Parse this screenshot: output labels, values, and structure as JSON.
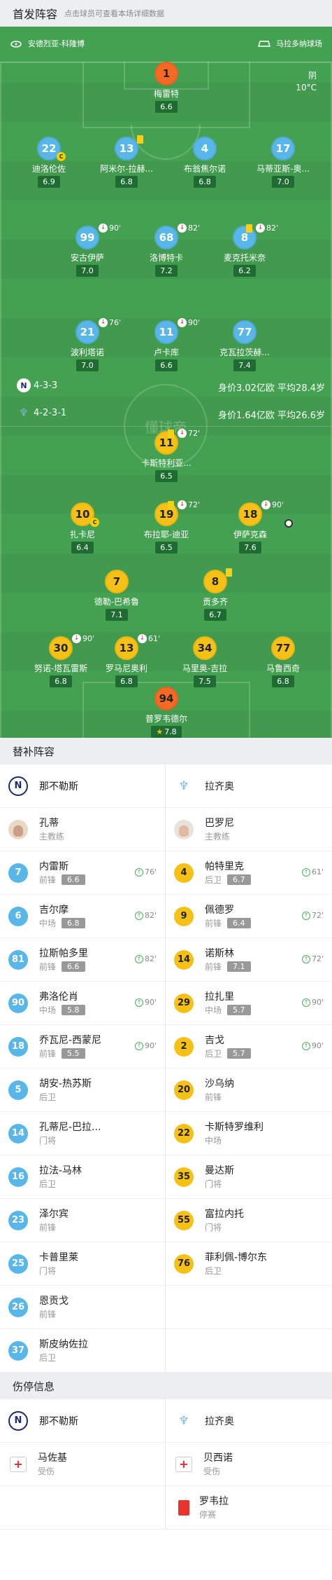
{
  "header": {
    "title": "首发阵容",
    "subtitle": "点击球员可查看本场详细数据"
  },
  "venue": {
    "stadium": "安德烈亚-科隆博",
    "stadium2": "马拉多纳球场"
  },
  "weather": {
    "condition": "阴",
    "temp": "10°C"
  },
  "watermark": "懂球帝",
  "napoli_form": {
    "formation": "4-3-3",
    "value": "身价3.02亿欧  平均28.4岁"
  },
  "lazio_form": {
    "formation": "4-2-3-1",
    "value": "身价1.64亿欧  平均26.6岁"
  },
  "pitch_players": [
    {
      "num": "1",
      "name": "梅雷特",
      "rating": "6.6",
      "color": "orange"
    },
    {
      "num": "22",
      "name": "迪洛伦佐",
      "rating": "6.9",
      "color": "blue",
      "captain": "C"
    },
    {
      "num": "13",
      "name": "阿米尔-拉赫...",
      "rating": "6.8",
      "color": "blue",
      "yellow": true
    },
    {
      "num": "4",
      "name": "布翁焦尔诺",
      "rating": "6.8",
      "color": "blue"
    },
    {
      "num": "17",
      "name": "马蒂亚斯-奥...",
      "rating": "7.0",
      "color": "blue"
    },
    {
      "num": "99",
      "name": "安古伊萨",
      "rating": "7.0",
      "color": "blue",
      "sub": "90'"
    },
    {
      "num": "68",
      "name": "洛博特卡",
      "rating": "7.2",
      "color": "blue",
      "sub": "82'"
    },
    {
      "num": "8",
      "name": "麦克托米奈",
      "rating": "6.2",
      "color": "blue",
      "sub": "82'",
      "yellow": true
    },
    {
      "num": "21",
      "name": "波利塔诺",
      "rating": "7.0",
      "color": "blue",
      "sub": "76'"
    },
    {
      "num": "11",
      "name": "卢卡库",
      "rating": "6.6",
      "color": "blue",
      "sub": "90'"
    },
    {
      "num": "77",
      "name": "克瓦拉茨赫...",
      "rating": "7.4",
      "color": "blue"
    },
    {
      "num": "11",
      "name": "卡斯特利亚...",
      "rating": "6.5",
      "color": "yellow",
      "sub": "72'",
      "yellow": true
    },
    {
      "num": "10",
      "name": "扎卡尼",
      "rating": "6.4",
      "color": "yellow",
      "captain": "C"
    },
    {
      "num": "19",
      "name": "布拉耶-迪亚",
      "rating": "6.5",
      "color": "yellow",
      "sub": "72'",
      "yellow": true
    },
    {
      "num": "18",
      "name": "伊萨克森",
      "rating": "7.6",
      "color": "yellow",
      "sub": "90'",
      "goal": true
    },
    {
      "num": "7",
      "name": "德勒-巴希鲁",
      "rating": "7.1",
      "color": "yellow"
    },
    {
      "num": "8",
      "name": "贡多齐",
      "rating": "6.7",
      "color": "yellow",
      "yellow": true
    },
    {
      "num": "30",
      "name": "努诺-塔瓦雷斯",
      "rating": "6.8",
      "color": "yellow",
      "sub": "90'"
    },
    {
      "num": "13",
      "name": "罗马尼奥利",
      "rating": "6.8",
      "color": "yellow",
      "sub": "61'"
    },
    {
      "num": "34",
      "name": "马里奥-吉拉",
      "rating": "7.5",
      "color": "yellow"
    },
    {
      "num": "77",
      "name": "马鲁西奇",
      "rating": "6.8",
      "color": "yellow"
    },
    {
      "num": "94",
      "name": "普罗韦德尔",
      "rating": "7.8",
      "color": "orange",
      "star": "★"
    }
  ],
  "bench_title": "替补阵容",
  "teams": {
    "napoli": "那不勒斯",
    "lazio": "拉齐奥"
  },
  "coaches": {
    "napoli": {
      "name": "孔蒂",
      "role": "主教练"
    },
    "lazio": {
      "name": "巴罗尼",
      "role": "主教练"
    }
  },
  "bench_napoli": [
    {
      "num": "7",
      "name": "内雷斯",
      "pos": "前锋",
      "rating": "6.6",
      "on": "76'"
    },
    {
      "num": "6",
      "name": "吉尔摩",
      "pos": "中场",
      "rating": "6.8",
      "on": "82'"
    },
    {
      "num": "81",
      "name": "拉斯帕多里",
      "pos": "前锋",
      "rating": "6.6",
      "on": "82'"
    },
    {
      "num": "90",
      "name": "弗洛伦肖",
      "pos": "中场",
      "rating": "5.8",
      "on": "90'"
    },
    {
      "num": "18",
      "name": "乔瓦尼-西蒙尼",
      "pos": "前锋",
      "rating": "5.5",
      "on": "90'"
    },
    {
      "num": "5",
      "name": "胡安-热苏斯",
      "pos": "后卫"
    },
    {
      "num": "14",
      "name": "孔蒂尼-巴拉...",
      "pos": "门将"
    },
    {
      "num": "16",
      "name": "拉法-马林",
      "pos": "后卫"
    },
    {
      "num": "23",
      "name": "泽尔宾",
      "pos": "前锋"
    },
    {
      "num": "25",
      "name": "卡普里莱",
      "pos": "门将"
    },
    {
      "num": "26",
      "name": "恩贡戈",
      "pos": "前锋"
    },
    {
      "num": "37",
      "name": "斯皮纳佐拉",
      "pos": "后卫"
    }
  ],
  "bench_lazio": [
    {
      "num": "4",
      "name": "帕特里克",
      "pos": "后卫",
      "rating": "6.7",
      "on": "61'"
    },
    {
      "num": "9",
      "name": "佩德罗",
      "pos": "前锋",
      "rating": "6.4",
      "on": "72'"
    },
    {
      "num": "14",
      "name": "诺斯林",
      "pos": "前锋",
      "rating": "7.1",
      "on": "72'"
    },
    {
      "num": "29",
      "name": "拉扎里",
      "pos": "中场",
      "rating": "5.7",
      "on": "90'"
    },
    {
      "num": "2",
      "name": "吉戈",
      "pos": "后卫",
      "rating": "5.7",
      "on": "90'"
    },
    {
      "num": "20",
      "name": "沙乌纳",
      "pos": "前锋"
    },
    {
      "num": "22",
      "name": "卡斯特罗维利",
      "pos": "中场"
    },
    {
      "num": "35",
      "name": "曼达斯",
      "pos": "门将"
    },
    {
      "num": "55",
      "name": "富拉内托",
      "pos": "门将"
    },
    {
      "num": "76",
      "name": "菲利佩-博尔东",
      "pos": "后卫"
    }
  ],
  "injury_title": "伤停信息",
  "injuries": {
    "napoli": [
      {
        "name": "马佐基",
        "status": "受伤"
      }
    ],
    "lazio": [
      {
        "name": "贝西诺",
        "status": "受伤"
      },
      {
        "name": "罗韦拉",
        "status": "停赛"
      }
    ]
  },
  "colors": {
    "pitch": "#45a152",
    "napoli": "#58b6e8",
    "lazio": "#f5c116",
    "gk": "#f26a23"
  }
}
